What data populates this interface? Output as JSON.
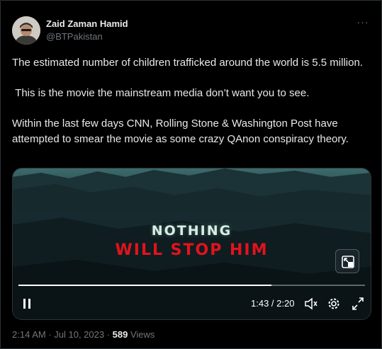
{
  "author": {
    "name": "Zaid Zaman Hamid",
    "handle": "@BTPakistan"
  },
  "tweet": {
    "text": "The estimated number of children trafficked around the world is 5.5 million.\n\n This is the movie the mainstream media don’t want you to see.\n\nWithin the last few days CNN, Rolling Stone & Washington Post have attempted to smear the movie as some crazy QAnon conspiracy theory."
  },
  "video": {
    "title_line1": "NOTHING",
    "title_line2": "WILL STOP HIM",
    "time_display": "1:43 / 2:20",
    "progress_fraction": 0.73,
    "accent_red": "#e4121c"
  },
  "footer": {
    "timestamp": "2:14 AM · Jul 10, 2023",
    "separator": " · ",
    "views_count": "589",
    "views_label": " Views"
  },
  "icons": {
    "more": "more-icon",
    "pause": "pause-icon",
    "volume": "volume-icon",
    "settings": "gear-icon",
    "fullscreen": "fullscreen-icon",
    "pip": "picture-in-picture-icon"
  }
}
